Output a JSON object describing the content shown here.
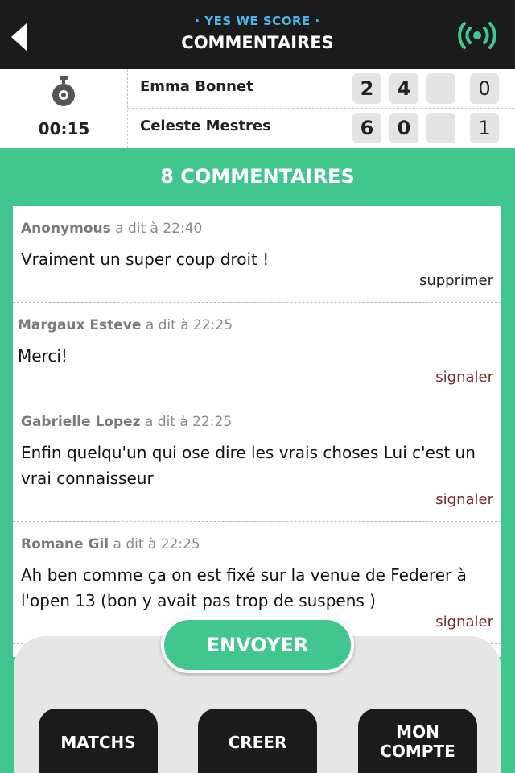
{
  "header": {
    "brand": "· YES WE SCORE ·",
    "title": "COMMENTAIRES",
    "back_icon": "back-arrow-icon",
    "live_icon": "live-broadcast-icon"
  },
  "match": {
    "timer_icon": "stopwatch-icon",
    "time": "00:15",
    "players": [
      {
        "name": "Emma Bonnet",
        "scores": [
          "2",
          "4",
          "",
          "0"
        ]
      },
      {
        "name": "Celeste Mestres",
        "scores": [
          "6",
          "0",
          "",
          "1"
        ]
      }
    ]
  },
  "comments_title": "8 COMMENTAIRES",
  "comments": [
    {
      "author": "Anonymous",
      "said": "a dit à 22:40",
      "text": "Vraiment un super coup droit !",
      "action": "supprimer"
    },
    {
      "author": "Margaux Esteve",
      "said": "a dit à 22:25",
      "text": "Merci!",
      "action": "signaler"
    },
    {
      "author": "Gabrielle Lopez",
      "said": "a dit à 22:25",
      "text": "Enfin quelqu'un qui ose dire les vrais choses Lui c'est un vrai connaisseur",
      "action": "signaler"
    },
    {
      "author": "Romane Gil",
      "said": "a dit à 22:25",
      "text": "Ah ben comme ça on est fixé sur la venue de Federer à l'open 13 (bon y avait pas trop de suspens )",
      "action": "signaler"
    }
  ],
  "send_label": "ENVOYER",
  "nav": {
    "matchs": "MATCHS",
    "creer": "CREER",
    "compte_line1": "MON",
    "compte_line2": "COMPTE"
  },
  "colors": {
    "accent": "#41c68f",
    "brand": "#4ab7e8",
    "bar": "#1b1b1b",
    "report": "#7a2a2a"
  }
}
